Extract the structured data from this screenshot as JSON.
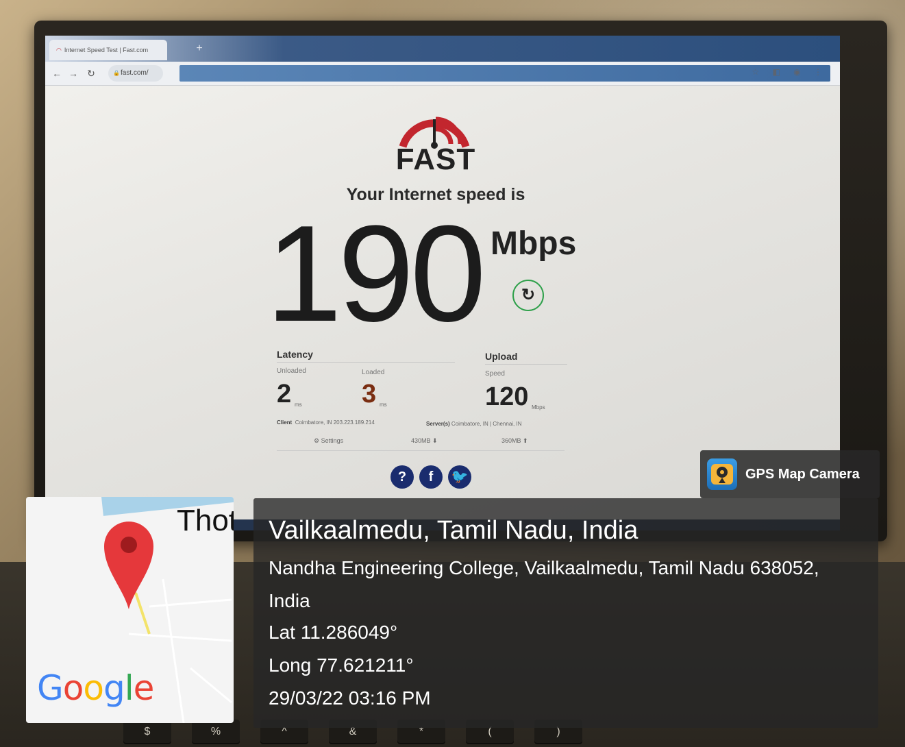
{
  "browser": {
    "tab_title": "Internet Speed Test | Fast.com",
    "url": "fast.com/"
  },
  "fast": {
    "logo_text": "FAST",
    "speed_label": "Your Internet speed is",
    "speed_value": "190",
    "speed_unit": "Mbps",
    "latency": {
      "label": "Latency",
      "unloaded_label": "Unloaded",
      "unloaded_value": "2",
      "unloaded_unit": "ms",
      "loaded_label": "Loaded",
      "loaded_value": "3",
      "loaded_unit": "ms"
    },
    "upload": {
      "label": "Upload",
      "speed_label": "Speed",
      "value": "120",
      "unit": "Mbps"
    },
    "client_label": "Client",
    "client_value": "Coimbatore, IN   203.223.189.214",
    "servers_label": "Server(s)",
    "servers_value": "Coimbatore, IN  |  Chennai, IN",
    "settings_label": "Settings",
    "download_data": "430MB",
    "upload_data": "360MB"
  },
  "gps": {
    "app_name": "GPS Map Camera",
    "location_title": "Vailkaalmedu, Tamil Nadu, India",
    "address_line1": "Nandha Engineering College, Vailkaalmedu, Tamil Nadu 638052,",
    "address_line2": "India",
    "lat": "Lat 11.286049°",
    "long": "Long 77.621211°",
    "datetime": "29/03/22 03:16 PM"
  },
  "map": {
    "place_label": "Thot",
    "provider": "Google"
  },
  "keyboard": {
    "keys": [
      "$",
      "%",
      "^",
      "&",
      "*",
      "(",
      ")"
    ]
  },
  "colors": {
    "fast_red": "#c2262e",
    "refresh_green": "#2ea04a",
    "social_navy": "#1a2c6e",
    "overlay_dark": "#262626"
  }
}
